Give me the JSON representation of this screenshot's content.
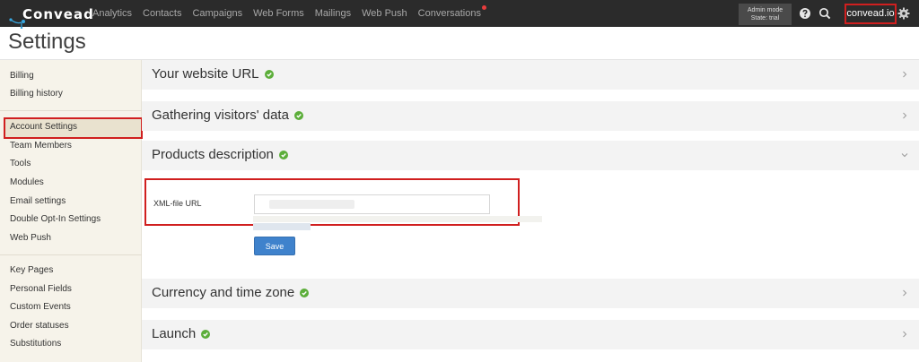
{
  "app": {
    "logo_text": "Convead"
  },
  "nav": {
    "items": [
      "Analytics",
      "Contacts",
      "Campaigns",
      "Web Forms",
      "Mailings",
      "Web Push",
      "Conversations"
    ],
    "admin_mode": "Admin mode",
    "state": "State: trial",
    "account": "convead.io"
  },
  "page": {
    "title": "Settings"
  },
  "sidebar": {
    "group1": [
      "Billing",
      "Billing history"
    ],
    "group2": [
      "Account Settings",
      "Team Members",
      "Tools",
      "Modules",
      "Email settings",
      "Double Opt-In Settings",
      "Web Push"
    ],
    "group3": [
      "Key Pages",
      "Personal Fields",
      "Custom Events",
      "Order statuses",
      "Substitutions"
    ],
    "active": "Account Settings"
  },
  "sections": [
    {
      "title": "Your website URL",
      "complete": true,
      "expanded": false
    },
    {
      "title": "Gathering visitors' data",
      "complete": true,
      "expanded": false
    },
    {
      "title": "Products description",
      "complete": true,
      "expanded": true
    },
    {
      "title": "Currency and time zone",
      "complete": true,
      "expanded": false
    },
    {
      "title": "Launch",
      "complete": true,
      "expanded": false
    }
  ],
  "products_form": {
    "label": "XML-file URL",
    "value": "",
    "save_label": "Save"
  },
  "icons": {
    "help": "help-circle-icon",
    "search": "search-icon",
    "settings": "gear-icon",
    "check": "check-circle-icon",
    "chevron_right": "chevron-right-icon",
    "chevron_down": "chevron-down-icon"
  },
  "colors": {
    "topbar": "#2b2b2b",
    "accent_red": "#d01f1f",
    "check_green": "#5cae3a",
    "save_blue": "#3f82cc",
    "sidebar_bg": "#f6f3ea"
  }
}
